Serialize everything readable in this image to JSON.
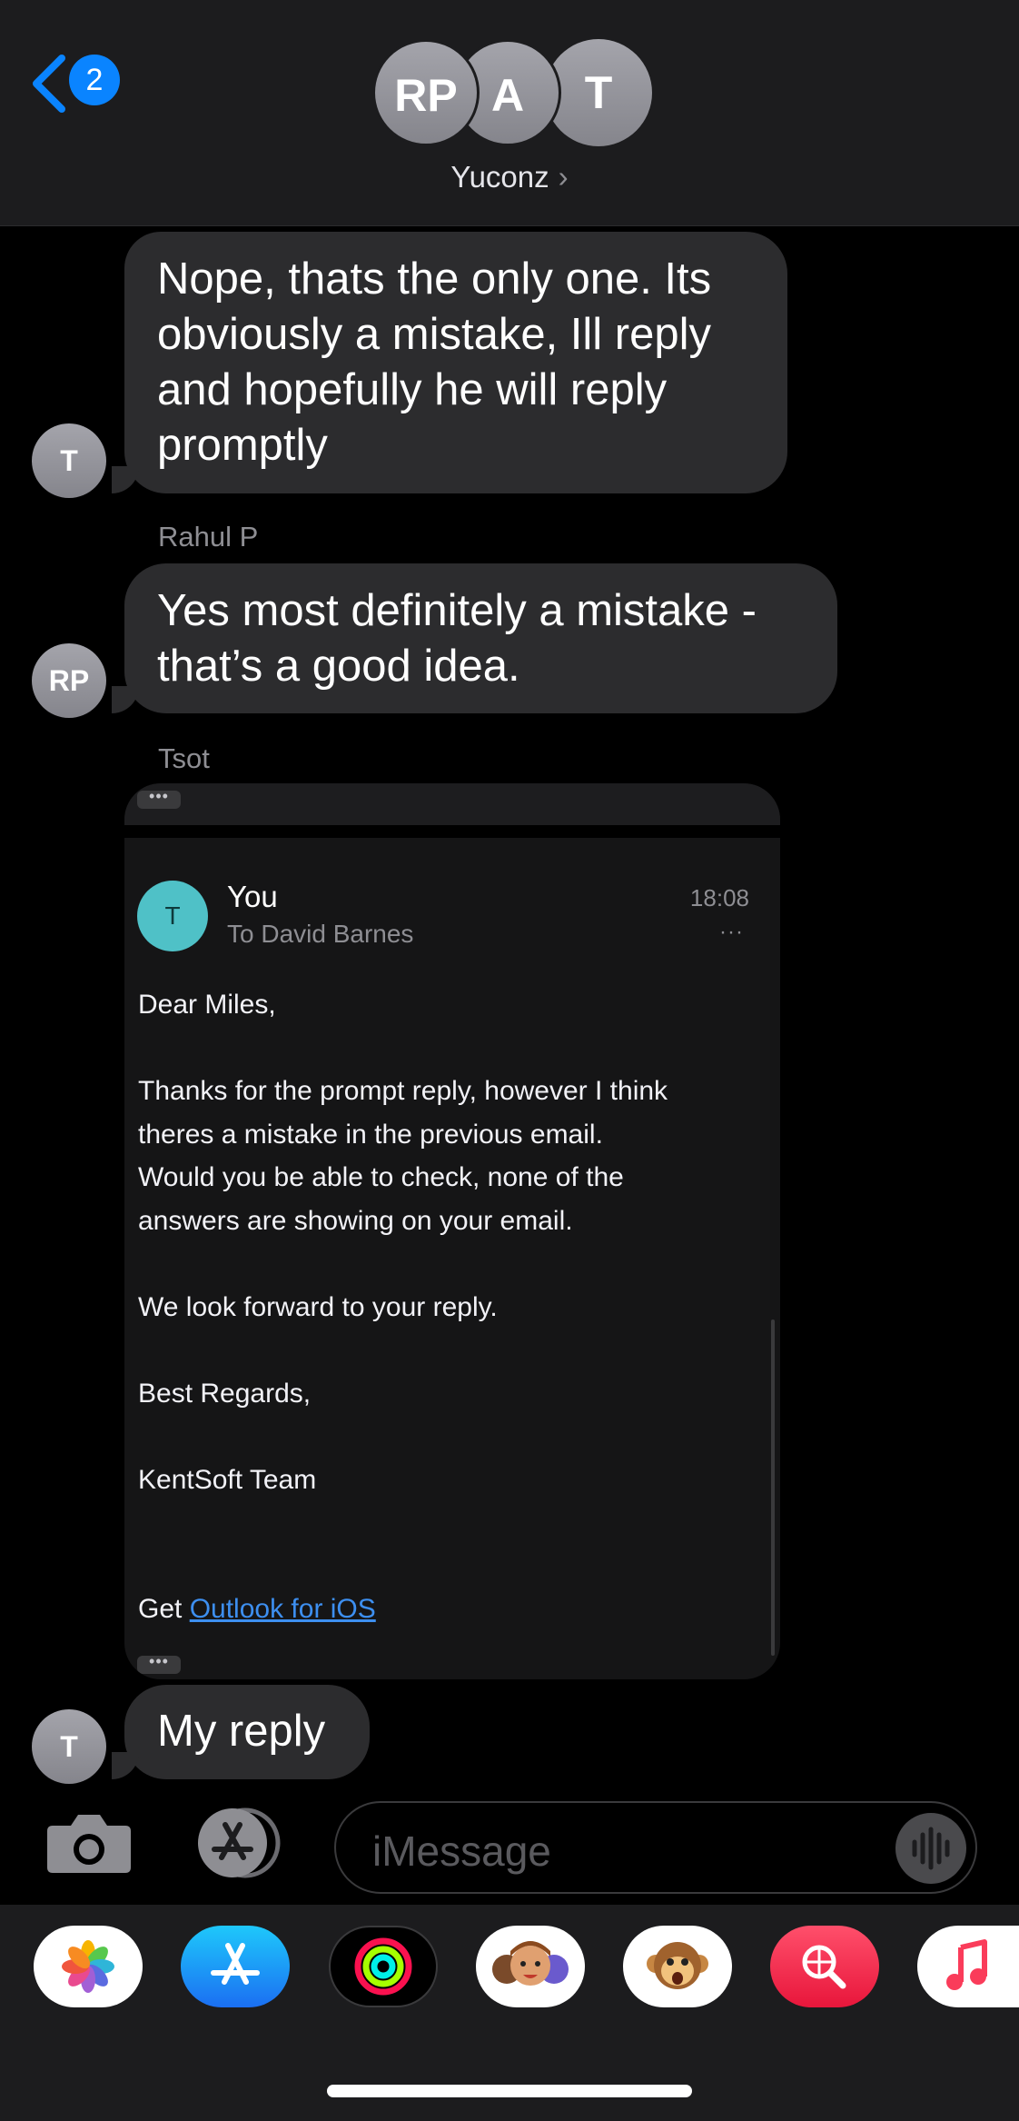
{
  "header": {
    "back_badge": "2",
    "avatars": [
      "RP",
      "A",
      "T"
    ],
    "group_name": "Yuconz",
    "chevron": "›"
  },
  "messages": [
    {
      "avatar": "T",
      "text": "Nope, thats the only one. Its obviously a mistake, Ill reply and hopefully he will reply promptly",
      "lines": [
        "Nope, thats the only one. Its",
        "obviously a mistake, Ill reply",
        "and hopefully he will reply",
        "promptly"
      ]
    },
    {
      "sender": "Rahul P",
      "avatar": "RP",
      "lines": [
        "Yes most definitely a mistake -",
        "that’s a good idea."
      ]
    },
    {
      "sender": "Tsot"
    },
    {
      "avatar": "T",
      "text": "My reply"
    }
  ],
  "email": {
    "avatar": "T",
    "from": "You",
    "to": "To David Barnes",
    "time": "18:08",
    "more": "···",
    "greeting": "Dear Miles,",
    "paragraph_lines": [
      "Thanks for the prompt reply, however I think",
      "theres a mistake in the previous email.",
      "Would you be able to check, none of the",
      "answers are showing on your email."
    ],
    "closing_line": "We look forward to your reply.",
    "regards": "Best Regards,",
    "signature": "KentSoft Team",
    "footer_prefix": "Get ",
    "footer_link": "Outlook for iOS",
    "dots": "•••"
  },
  "input": {
    "placeholder": "iMessage"
  },
  "drawer": {
    "apps": [
      "photos-app-icon",
      "app-store-app-icon",
      "activity-app-icon",
      "memoji-app-icon",
      "animoji-app-icon",
      "web-search-app-icon",
      "music-app-icon"
    ]
  },
  "colors": {
    "accent": "#0a84ff",
    "bubble": "#2c2c2e",
    "background": "#000000",
    "link": "#3d8ff0"
  }
}
